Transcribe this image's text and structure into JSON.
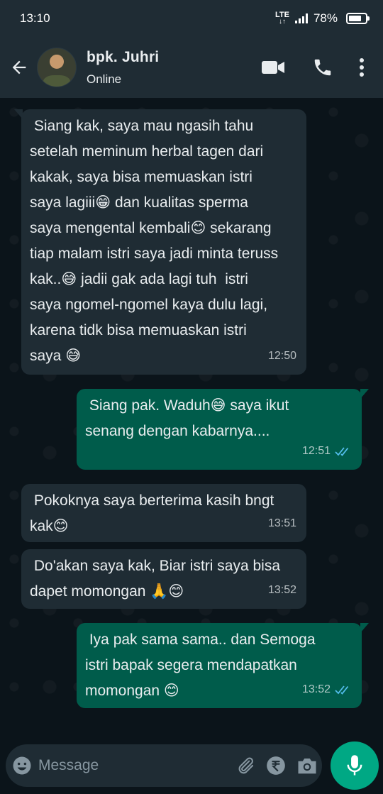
{
  "status_bar": {
    "time": "13:10",
    "network": "LTE",
    "battery_percent": "78%",
    "battery_level": 0.78
  },
  "header": {
    "contact_name": "bpk. Juhri",
    "contact_status": "Online"
  },
  "messages": [
    {
      "direction": "incoming",
      "text": " Siang kak, saya mau ngasih tahu\nsetelah meminum herbal tagen dari\nkakak, saya bisa memuaskan istri\nsaya lagiii😁 dan kualitas sperma\nsaya mengental kembali😊 sekarang\ntiap malam istri saya jadi minta teruss\nkak..😅 jadii gak ada lagi tuh  istri\nsaya ngomel-ngomel kaya dulu lagi,\nkarena tidk bisa memuaskan istri\nsaya 😅",
      "time": "12:50"
    },
    {
      "direction": "outgoing",
      "text": " Siang pak. Waduh😅 saya ikut\nsenang dengan kabarnya....",
      "time": "12:51"
    },
    {
      "direction": "incoming",
      "text": " Pokoknya saya berterima kasih bngt\nkak😊",
      "time": "13:51"
    },
    {
      "direction": "incoming",
      "text": " Do'akan saya kak, Biar istri saya bisa\ndapet momongan 🙏😊",
      "time": "13:52"
    },
    {
      "direction": "outgoing",
      "text": " Iya pak sama sama.. dan Semoga\nistri bapak segera mendapatkan\nmomongan 😊",
      "time": "13:52"
    }
  ],
  "input": {
    "placeholder": "Message"
  },
  "colors": {
    "header_bg": "#1f2c34",
    "chat_bg": "#0b141a",
    "incoming_bubble": "#1f2c34",
    "outgoing_bubble": "#005c4b",
    "accent": "#00a884",
    "read_ticks": "#53bdeb"
  },
  "icons": {
    "back": "arrow-left-icon",
    "video": "video-call-icon",
    "voice": "phone-icon",
    "menu": "more-vertical-icon",
    "emoji": "emoji-icon",
    "attach": "paperclip-icon",
    "payment": "rupee-icon",
    "camera": "camera-icon",
    "mic": "microphone-icon"
  }
}
